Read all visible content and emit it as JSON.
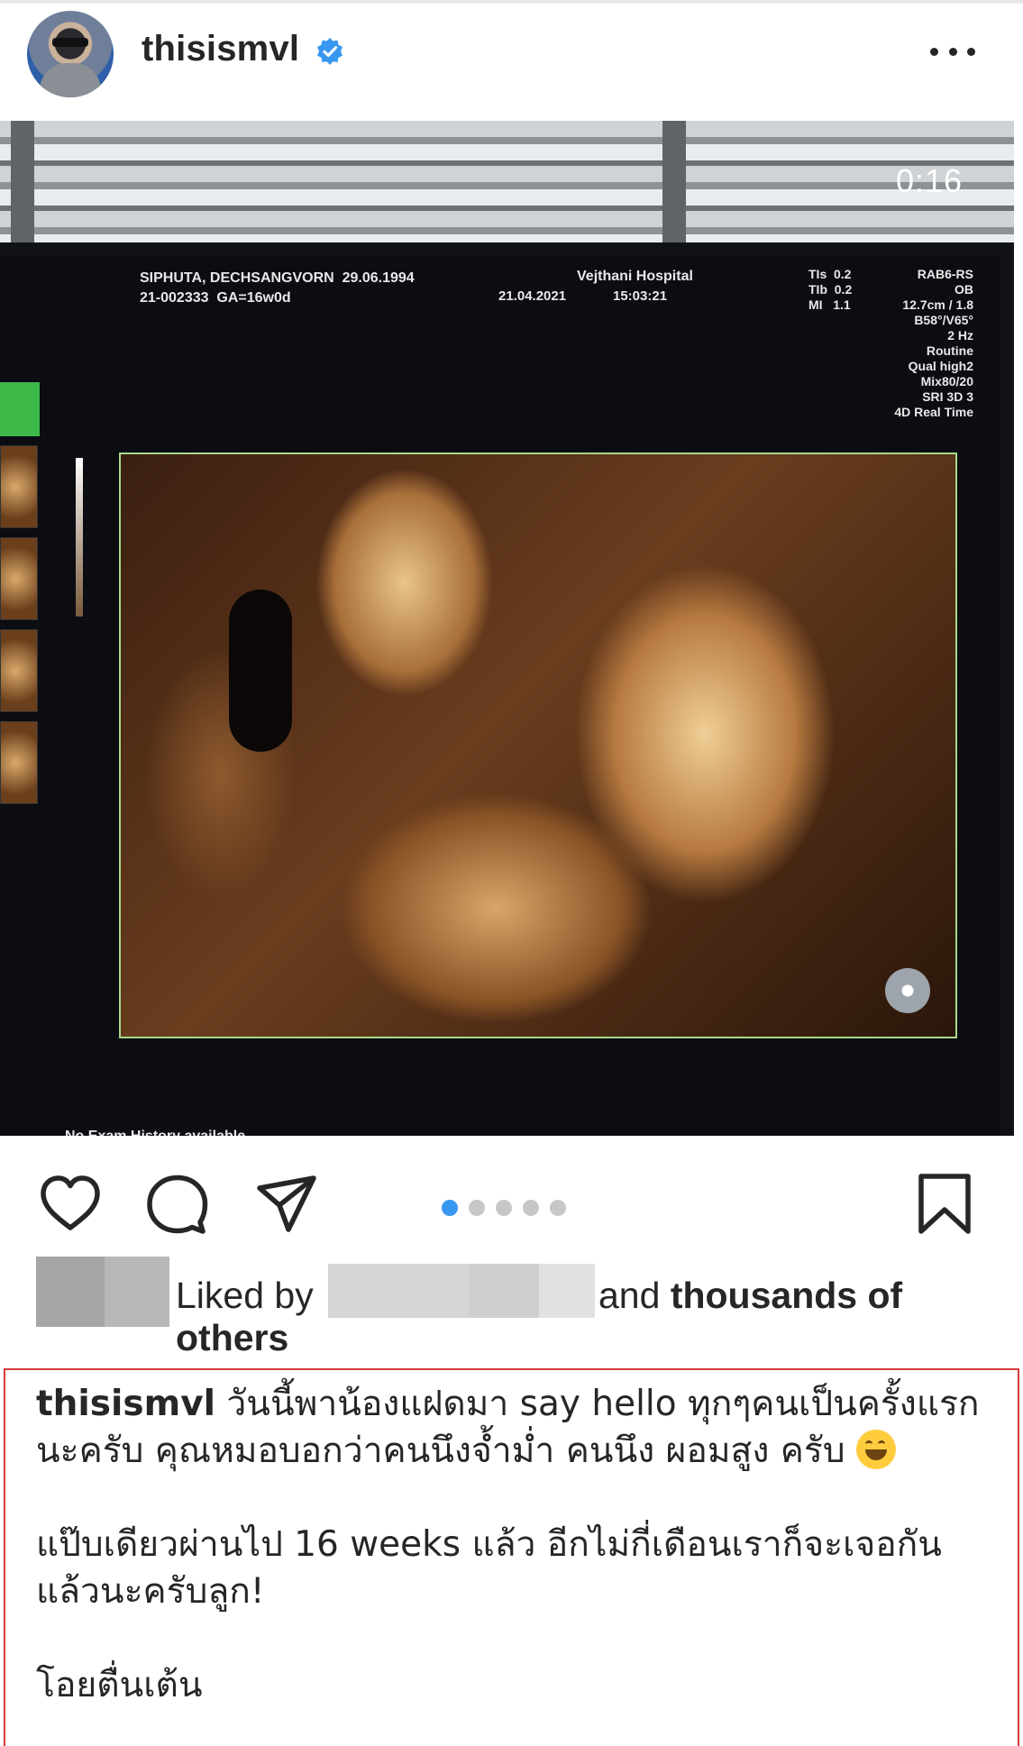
{
  "post": {
    "username": "thisismvl",
    "verified": true,
    "more_icon": "more-horizontal-icon"
  },
  "media": {
    "video_timer": "0:16",
    "scan": {
      "patient_line1": "SIPHUTA, DECHSANGVORN  29.06.1994",
      "patient_line2": "21-002333  GA=16w0d",
      "hospital": "Vejthani Hospital",
      "date": "21.04.2021",
      "time": "15:03:21",
      "params": "TIs  0.2\nTIb  0.2\nMI   1.1",
      "settings": "RAB6-RS\nOB\n12.7cm / 1.8\nB58°/V65°\n2 Hz\nRoutine\nQual high2\nMix80/20\nSRI 3D 3\n4D Real Time",
      "no_exam": "No Exam History available"
    },
    "carousel": {
      "count": 5,
      "active_index": 0
    }
  },
  "actions": {
    "like_icon": "heart-icon",
    "comment_icon": "comment-icon",
    "share_icon": "send-icon",
    "save_icon": "bookmark-icon"
  },
  "likes": {
    "prefix": "Liked by",
    "and": "and ",
    "suffix_line1": "thousands of",
    "suffix_line2": "others"
  },
  "caption": {
    "username": "thisismvl",
    "line1": " วันนี้พาน้องแฝดมา say hello ทุกๆคนเป็นครั้งแรก",
    "line2": "นะครับ คุณหมอบอกว่าคนนึงจ้ำม่ำ คนนึง ผอมสูง ครับ ",
    "line3": "แป๊บเดียวผ่านไป 16 weeks แล้ว อีกไม่กี่เดือนเราก็จะเจอกัน",
    "line4": "แล้วนะครับลูก!",
    "line5": "โอยตื่นเต้น",
    "emoji": "grinning-face-emoji"
  },
  "colors": {
    "text": "#262626",
    "verified_blue": "#3897f0",
    "carousel_active": "#3897f0",
    "carousel_inactive": "#c7c7c7",
    "highlight_border": "#d63c3c"
  }
}
